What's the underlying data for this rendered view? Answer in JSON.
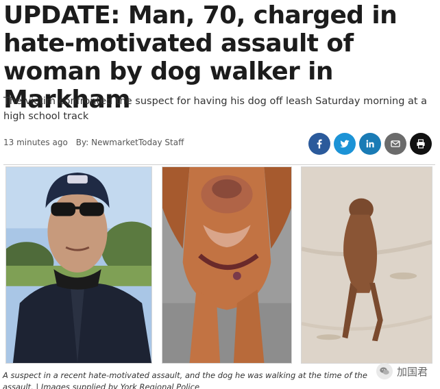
{
  "article": {
    "headline": "UPDATE: Man, 70, charged in hate-motivated assault of woman by dog walker in Markham",
    "subheadline": "The victim confronted the suspect for having his dog off leash Saturday morning at a high school track",
    "timestamp": "13 minutes ago",
    "byline": "By: NewmarketToday Staff",
    "caption": "A suspect in a recent hate-motivated assault, and the dog he was walking at the time of the assault. | Images supplied by York Regional Police"
  },
  "share": [
    {
      "name": "facebook",
      "icon": "facebook-icon",
      "color": "#2b5a9b"
    },
    {
      "name": "twitter",
      "icon": "twitter-icon",
      "color": "#1c93d6"
    },
    {
      "name": "linkedin",
      "icon": "linkedin-icon",
      "color": "#1a7bb5"
    },
    {
      "name": "email",
      "icon": "email-icon",
      "color": "#6b6b6b"
    },
    {
      "name": "print",
      "icon": "print-icon",
      "color": "#111111"
    }
  ],
  "watermark": {
    "text": "加国君",
    "icon": "wechat-icon"
  }
}
